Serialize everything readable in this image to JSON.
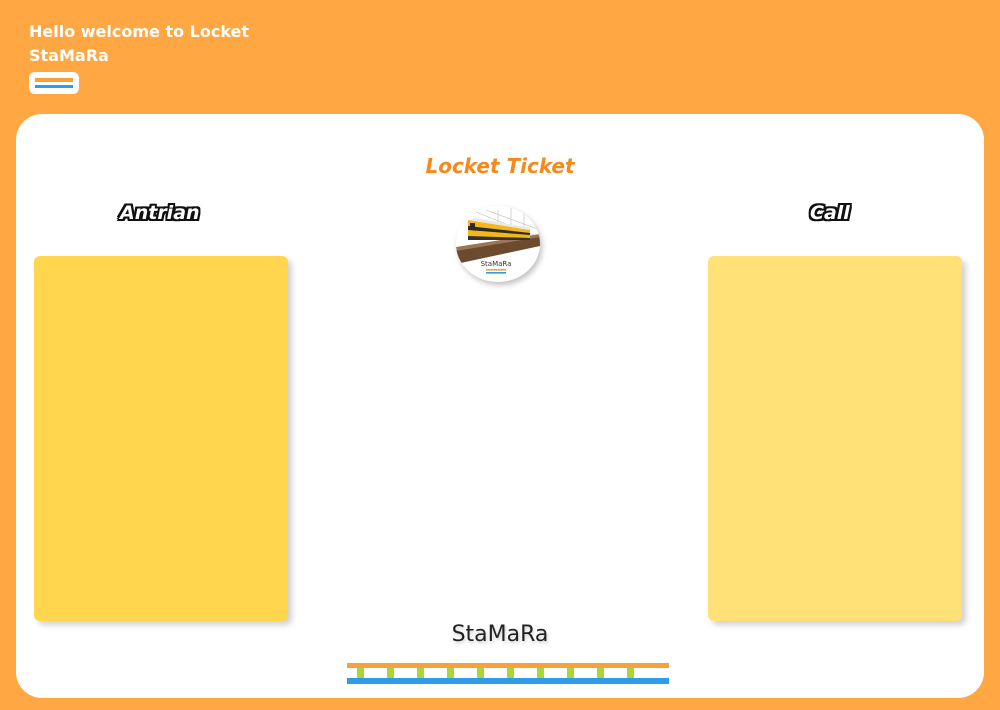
{
  "header": {
    "greeting": "Hello welcome to Locket",
    "brand": "StaMaRa",
    "logo_icon": "rail-logo-icon"
  },
  "main": {
    "title": "Locket Ticket",
    "left_label": "Antrian",
    "right_label": "Call",
    "center_logo": {
      "icon": "train-logo-icon",
      "caption": "StaMaRa"
    },
    "footer_brand": "StaMaRa"
  },
  "colors": {
    "background": "#FFA843",
    "accent_orange": "#F58A1C",
    "queue_panel": "#FFD64E",
    "call_panel": "#FFE177",
    "rail_blue": "#2F9BEA",
    "rail_green": "#A7D83A"
  }
}
